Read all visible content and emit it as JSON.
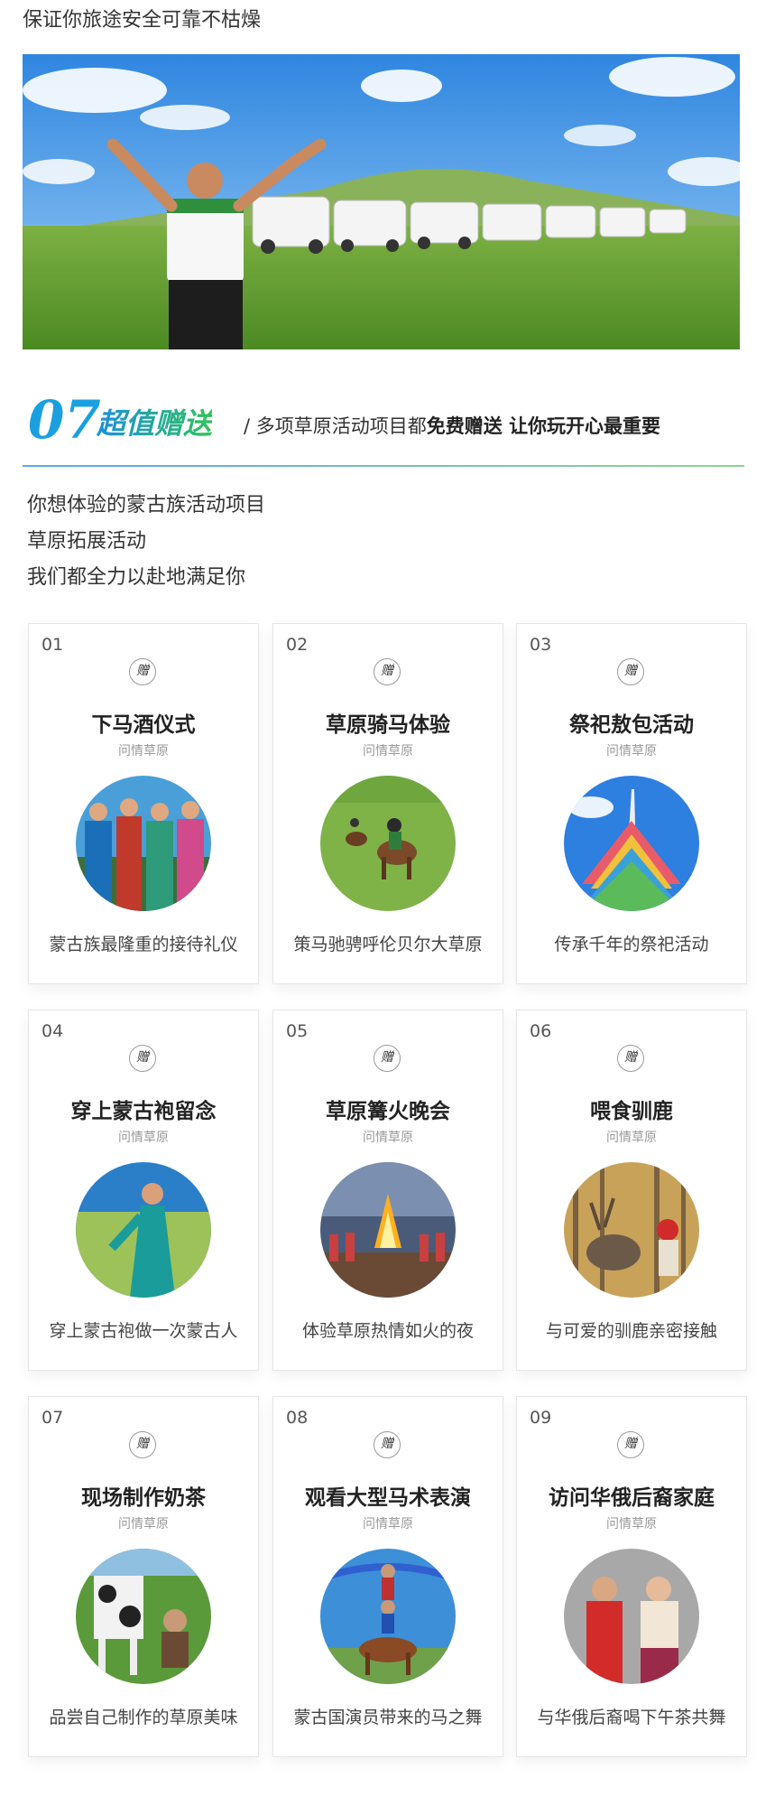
{
  "top_text": "保证你旅途安全可靠不枯燥",
  "section": {
    "number": "07",
    "title": "超值赠送",
    "desc_prefix": "/ 多项草原活动项目都",
    "desc_bold1": "免费赠送",
    "desc_bold2": "让你玩开心最重要"
  },
  "intro": [
    "你想体验的蒙古族活动项目",
    "草原拓展活动",
    "我们都全力以赴地满足你"
  ],
  "gift_label": "赠",
  "cards": [
    {
      "num": "01",
      "title": "下马酒仪式",
      "sub": "问情草原",
      "caption": "蒙古族最隆重的接待礼仪"
    },
    {
      "num": "02",
      "title": "草原骑马体验",
      "sub": "问情草原",
      "caption": "策马驰骋呼伦贝尔大草原"
    },
    {
      "num": "03",
      "title": "祭祀敖包活动",
      "sub": "问情草原",
      "caption": "传承千年的祭祀活动"
    },
    {
      "num": "04",
      "title": "穿上蒙古袍留念",
      "sub": "问情草原",
      "caption": "穿上蒙古袍做一次蒙古人"
    },
    {
      "num": "05",
      "title": "草原篝火晚会",
      "sub": "问情草原",
      "caption": "体验草原热情如火的夜"
    },
    {
      "num": "06",
      "title": "喂食驯鹿",
      "sub": "问情草原",
      "caption": "与可爱的驯鹿亲密接触"
    },
    {
      "num": "07",
      "title": "现场制作奶茶",
      "sub": "问情草原",
      "caption": "品尝自己制作的草原美味"
    },
    {
      "num": "08",
      "title": "观看大型马术表演",
      "sub": "问情草原",
      "caption": "蒙古国演员带来的马之舞"
    },
    {
      "num": "09",
      "title": "访问华俄后裔家庭",
      "sub": "问情草原",
      "caption": "与华俄后裔喝下午茶共舞"
    }
  ]
}
